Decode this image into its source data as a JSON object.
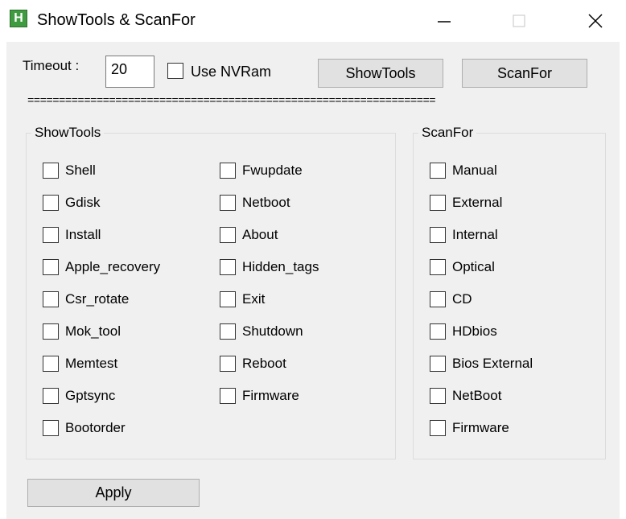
{
  "window": {
    "title": "ShowTools & ScanFor",
    "icon": "app-h-icon",
    "minimize_glyph": "—",
    "maximize_glyph": "☐",
    "close_glyph": "✕"
  },
  "top": {
    "timeout_label": "Timeout :",
    "timeout_value": "20",
    "nvram_label": "Use NVRam",
    "showtools_button": "ShowTools",
    "scanfor_button": "ScanFor",
    "separator": "================================================================="
  },
  "showtools": {
    "title": "ShowTools",
    "col1": [
      "Shell",
      "Gdisk",
      "Install",
      "Apple_recovery",
      "Csr_rotate",
      "Mok_tool",
      "Memtest",
      "Gptsync",
      "Bootorder"
    ],
    "col2": [
      "Fwupdate",
      "Netboot",
      "About",
      "Hidden_tags",
      "Exit",
      "Shutdown",
      "Reboot",
      "Firmware"
    ]
  },
  "scanfor": {
    "title": "ScanFor",
    "items": [
      "Manual",
      "External",
      "Internal",
      "Optical",
      "CD",
      "HDbios",
      "Bios External",
      "NetBoot",
      "Firmware"
    ]
  },
  "apply_button": "Apply"
}
